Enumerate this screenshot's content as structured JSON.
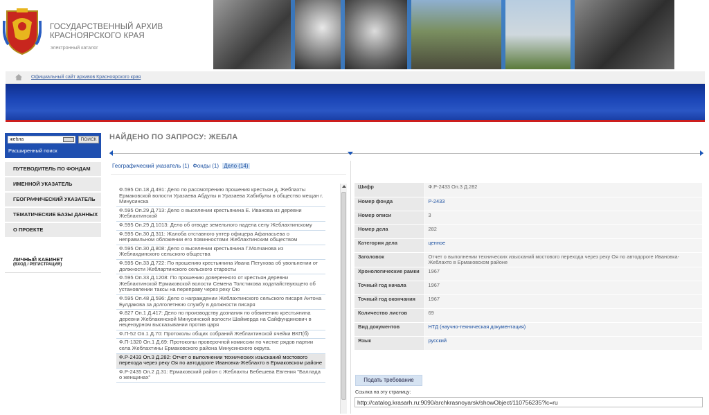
{
  "header": {
    "title_line1": "ГОСУДАРСТВЕННЫЙ АРХИВ",
    "title_line2": "КРАСНОЯРСКОГО КРАЯ",
    "subtitle": "электронный каталог"
  },
  "breadcrumb": {
    "link": "Официальный сайт архивов Красноярского края"
  },
  "search": {
    "value": "жебла",
    "button": "ПОИСК",
    "advanced": "Расширенный поиск"
  },
  "nav": {
    "items": [
      "ПУТЕВОДИТЕЛЬ ПО ФОНДАМ",
      "ИМЕННОЙ УКАЗАТЕЛЬ",
      "ГЕОГРАФИЧЕСКИЙ УКАЗАТЕЛЬ",
      "ТЕМАТИЧЕСКИЕ БАЗЫ ДАННЫХ",
      "О ПРОЕКТЕ"
    ],
    "cabinet_title": "ЛИЧНЫЙ КАБИНЕТ",
    "cabinet_sub": "(ВХОД / РЕГИСТРАЦИЯ)"
  },
  "main": {
    "title": "НАЙДЕНО ПО ЗАПРОСУ: ЖЕБЛА",
    "filters": {
      "geo": "Географический указатель (1)",
      "funds": "Фонды (1)",
      "cases": "Дело (14)"
    }
  },
  "results": [
    "Ф.595 Оп.18 Д.491: Дело по рассмотрению прошения крестьян д. Жеблахты Ермаковской волости Уразаева Абдулы и Уразаева Хабибулы в общество мещан г. Минусинска",
    "Ф.595 Оп.29 Д.713: Дело о выселении крестьянина Е. Иванова из деревни Жеблахтинской",
    "Ф.595 Оп.29 Д.1013: Дело об отводе земельного надела селу Жеблахтинскому",
    "Ф.595 Оп.30 Д.311: Жалоба отставного унтер офицера Афанасьева о неправильном обложении его повинностями Жеблахтинским обществом",
    "Ф.595 Оп.30 Д.808: Дело о выселении крестьянина Г.Молчанова из Жеблахдинского сельского общества",
    "Ф.595 Оп.33 Д.722: По прошению крестьянина Ивана Петухова об увольнении от должности Жеблартинского сельского старосты",
    "Ф.595 Оп.33 Д.1208: По прошению доверенного от крестьян деревни Жеблахтинской Ермаковской волости Семена Толстикова ходатайствующего об установлении таксы на переправу через реку Ою",
    "Ф.595 Оп.48 Д.596: Дело о награждении Жеблахтинского сельского писаря Антона Булдакова за долголетнюю службу в должности писаря",
    "Ф.827 Оп.1 Д.417: Дело по производству дознания по обвинению крестьянина деревни Жеблакинской Минусинской волости Шаймерда на Сайфундинович в нецензурном высказывании против царя",
    "Ф.П-52 Оп.1 Д.70: Протоколы общих собраний Жеблахтинской ячейки ВКП(б)",
    "Ф.П-1320 Оп.1 Д.69: Протоколы проверочной комиссии по чистке рядов партии села Жеблахтины Ермаковского района Минусинского округа.",
    "Ф.Р-2433 Оп.3 Д.282: Отчет о выполнении технических изысканий мостового перехода через реку Оя по автодороге Ивановка-Жеблахто в Ермаковском районе",
    "Ф.Р-2435 Оп.2 Д.31: Ермаковский район с Жеблахты Бебешева Евгения \"Баллада о женщинах\""
  ],
  "selected_index": 11,
  "detail": {
    "rows": [
      {
        "k": "Шифр",
        "v": "Ф.Р-2433 Оп.3 Д.282",
        "link": false
      },
      {
        "k": "Номер фонда",
        "v": "Р-2433",
        "link": true
      },
      {
        "k": "Номер описи",
        "v": "3",
        "link": false
      },
      {
        "k": "Номер дела",
        "v": "282",
        "link": false
      },
      {
        "k": "Категория дела",
        "v": "ценное",
        "link": true
      },
      {
        "k": "Заголовок",
        "v": "Отчет о выполнении технических изысканий мостового перехода через реку Оя по автодороге Ивановка-Жеблахто в Ермаковском районе",
        "link": false
      },
      {
        "k": "Хронологические рамки",
        "v": "1967",
        "link": false
      },
      {
        "k": "Точный год начала",
        "v": "1967",
        "link": false
      },
      {
        "k": "Точный год окончания",
        "v": "1967",
        "link": false
      },
      {
        "k": "Количество листов",
        "v": "69",
        "link": false
      },
      {
        "k": "Вид документов",
        "v": "НТД (научно-техническая документация)",
        "link": true
      },
      {
        "k": "Язык",
        "v": "русский",
        "link": true
      }
    ],
    "request_button": "Подать требование",
    "link_label": "Ссылка на эту страницу:",
    "link_value": "http://catalog.krasarh.ru:9090/archkrasnoyarsk/showObject/110756235?lc=ru"
  },
  "colors": {
    "accent": "#1f4fb0",
    "link": "#1a4fa0",
    "stripe_red": "#cc1e1e"
  }
}
